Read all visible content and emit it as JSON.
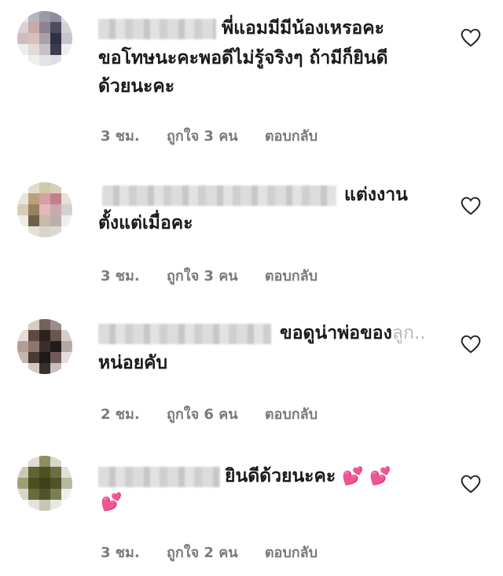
{
  "comments": [
    {
      "line1": "พี่แอมมีมีน้องเหรอคะ",
      "line2": "ขอโทษนะคะพอดีไม่รู้จริงๆ ถ้ามีก็ยินดี",
      "line3": "ด้วยนะคะ",
      "time": "3 ชม.",
      "likes": "ถูกใจ 3 คน",
      "reply": "ตอบกลับ"
    },
    {
      "line1": "แต่งงาน",
      "line2": "ตั้งแต่เมื่อคะ",
      "time": "3 ชม.",
      "likes": "ถูกใจ 3 คน",
      "reply": "ตอบกลับ"
    },
    {
      "line1": "ขอดูน่าพ่อของ",
      "line1_faded": "ลูก..",
      "line2": "หน่อยคับ",
      "time": "2 ชม.",
      "likes": "ถูกใจ 6 คน",
      "reply": "ตอบกลับ"
    },
    {
      "line1": "ยินดีด้วยนะคะ",
      "emoji": "💕 💕",
      "emoji2": "💕",
      "time": "3 ชม.",
      "likes": "ถูกใจ 2 คน",
      "reply": "ตอบกลับ"
    }
  ],
  "icons": {
    "like": "heart-outline-icon"
  },
  "colors": {
    "meta": "#7a7a7a",
    "text": "#1a1a1a",
    "emoji": "#ff3b8a"
  }
}
